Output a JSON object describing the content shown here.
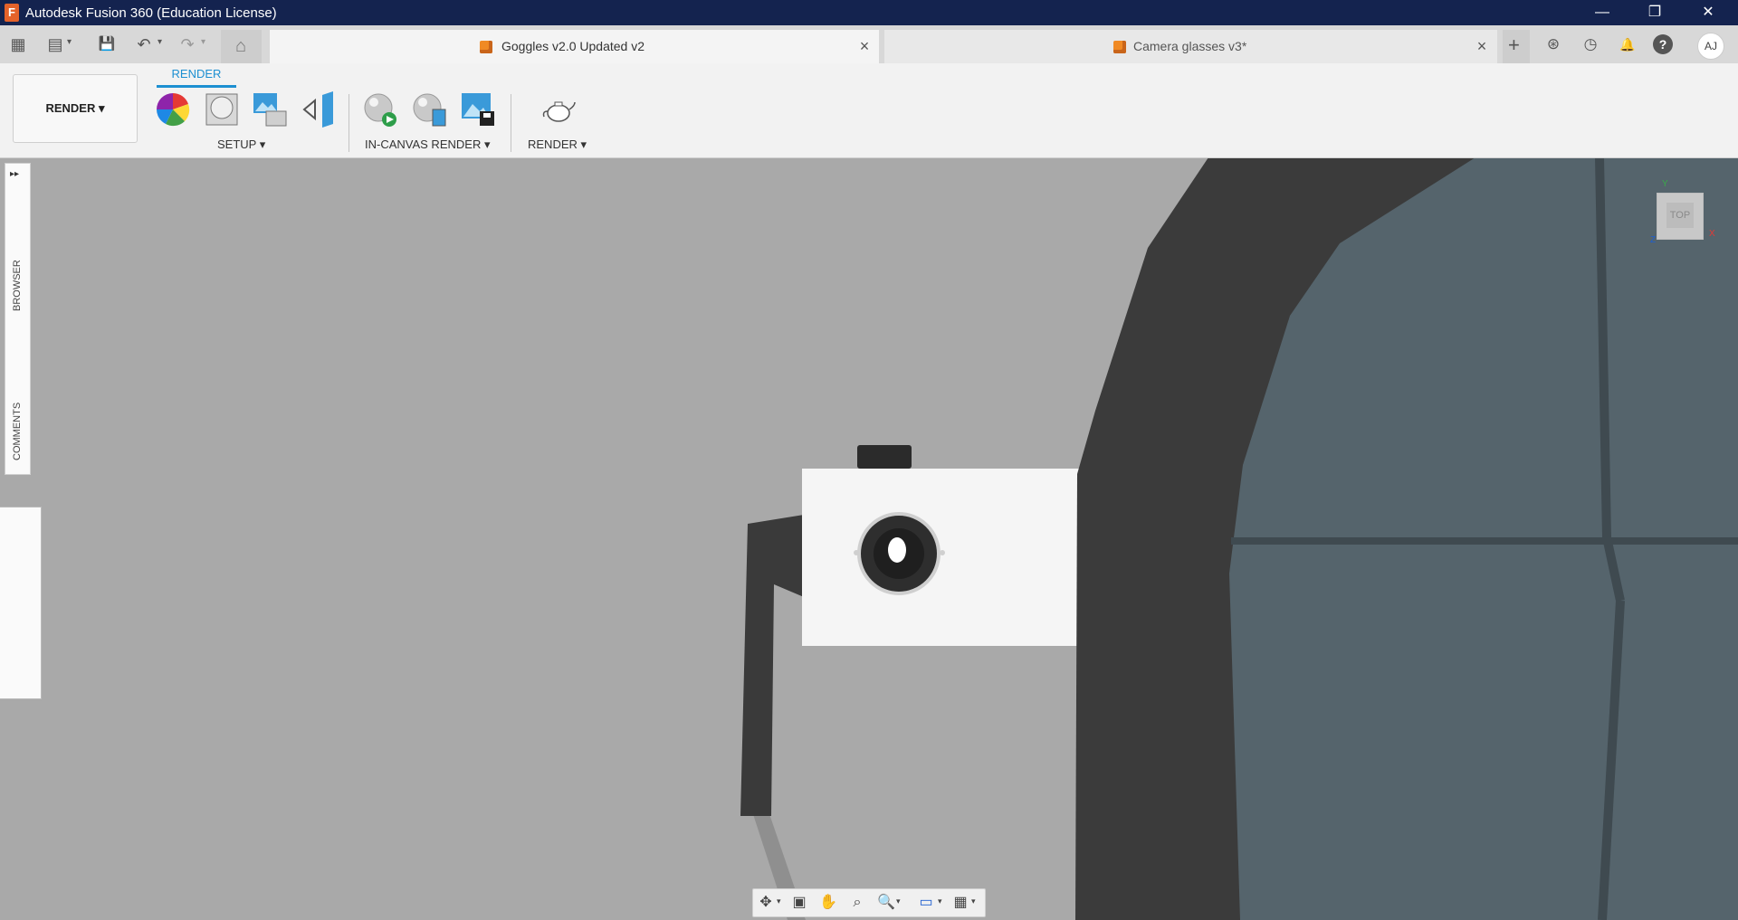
{
  "window": {
    "app_logo": "F",
    "title": "Autodesk Fusion 360 (Education License)",
    "minimize": "—",
    "restore": "❐",
    "close": "✕"
  },
  "tabs": [
    {
      "label": "Goggles v2.0 Updated v2",
      "active": true
    },
    {
      "label": "Camera glasses v3*",
      "active": false
    }
  ],
  "quick_access": {
    "grid": "▦",
    "file": "▤",
    "save": "💾",
    "undo": "↶",
    "redo": "↷",
    "home": "⌂",
    "new_tab": "+",
    "extensions": "⊛",
    "job_status": "◷",
    "notifications": "🔔",
    "help": "?",
    "avatar": "AJ"
  },
  "toolbar": {
    "workspace_label": "RENDER ▾",
    "ribbon_tab": "RENDER",
    "groups": [
      {
        "label": "SETUP ▾"
      },
      {
        "label": "IN-CANVAS RENDER ▾"
      },
      {
        "label": "RENDER ▾"
      }
    ]
  },
  "browser_panel": {
    "expand": "▸▸",
    "browser_label": "BROWSER",
    "comments_label": "COMMENTS"
  },
  "viewcube": {
    "face": "TOP",
    "axis_y": "Y",
    "axis_x": "X",
    "axis_z": "Z"
  },
  "colors": {
    "titlebar": "#14234f",
    "accent": "#1d8fd1",
    "viewport": "#a9a9a9",
    "frame": "#3b3b3b",
    "lens": "#55646c"
  }
}
